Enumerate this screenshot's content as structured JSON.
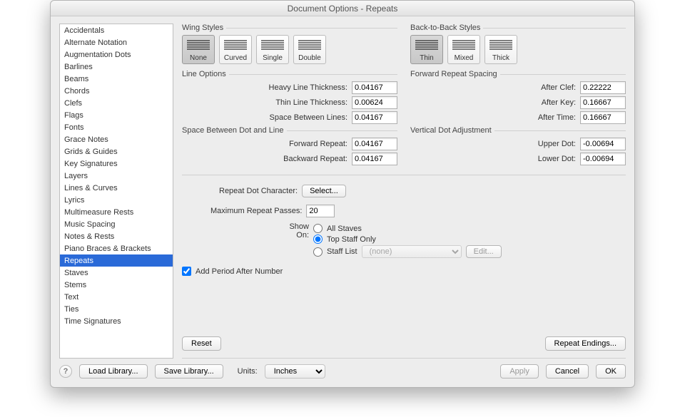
{
  "window": {
    "title": "Document Options - Repeats"
  },
  "sidebar": {
    "items": [
      "Accidentals",
      "Alternate Notation",
      "Augmentation Dots",
      "Barlines",
      "Beams",
      "Chords",
      "Clefs",
      "Flags",
      "Fonts",
      "Grace Notes",
      "Grids & Guides",
      "Key Signatures",
      "Layers",
      "Lines & Curves",
      "Lyrics",
      "Multimeasure Rests",
      "Music Spacing",
      "Notes & Rests",
      "Piano Braces & Brackets",
      "Repeats",
      "Staves",
      "Stems",
      "Text",
      "Ties",
      "Time Signatures"
    ],
    "selected": "Repeats"
  },
  "wingStyles": {
    "label": "Wing Styles",
    "options": [
      "None",
      "Curved",
      "Single",
      "Double"
    ],
    "selected": "None"
  },
  "backToBack": {
    "label": "Back-to-Back Styles",
    "options": [
      "Thin",
      "Mixed",
      "Thick"
    ],
    "selected": "Thin"
  },
  "lineOptions": {
    "label": "Line Options",
    "heavyLabel": "Heavy Line Thickness:",
    "heavy": "0.04167",
    "thinLabel": "Thin Line Thickness:",
    "thin": "0.00624",
    "spaceLabel": "Space Between Lines:",
    "space": "0.04167"
  },
  "spaceDotLine": {
    "label": "Space Between Dot and Line",
    "fwdLabel": "Forward Repeat:",
    "fwd": "0.04167",
    "bwdLabel": "Backward Repeat:",
    "bwd": "0.04167"
  },
  "forwardSpacing": {
    "label": "Forward Repeat Spacing",
    "clefLabel": "After Clef:",
    "clef": "0.22222",
    "keyLabel": "After Key:",
    "key": "0.16667",
    "timeLabel": "After Time:",
    "time": "0.16667"
  },
  "vertDot": {
    "label": "Vertical Dot Adjustment",
    "upperLabel": "Upper Dot:",
    "upper": "-0.00694",
    "lowerLabel": "Lower Dot:",
    "lower": "-0.00694"
  },
  "extras": {
    "repeatDotCharLabel": "Repeat Dot Character:",
    "selectBtn": "Select...",
    "maxPassesLabel": "Maximum Repeat Passes:",
    "maxPasses": "20",
    "showOnLabel": "Show On:",
    "allStaves": "All Staves",
    "topStaffOnly": "Top Staff Only",
    "staffList": "Staff List",
    "staffListValue": "(none)",
    "editBtn": "Edit...",
    "addPeriod": "Add Period After Number",
    "reset": "Reset",
    "repeatEndings": "Repeat Endings..."
  },
  "footer": {
    "loadLibrary": "Load Library...",
    "saveLibrary": "Save Library...",
    "unitsLabel": "Units:",
    "unitsValue": "Inches",
    "apply": "Apply",
    "cancel": "Cancel",
    "ok": "OK"
  }
}
